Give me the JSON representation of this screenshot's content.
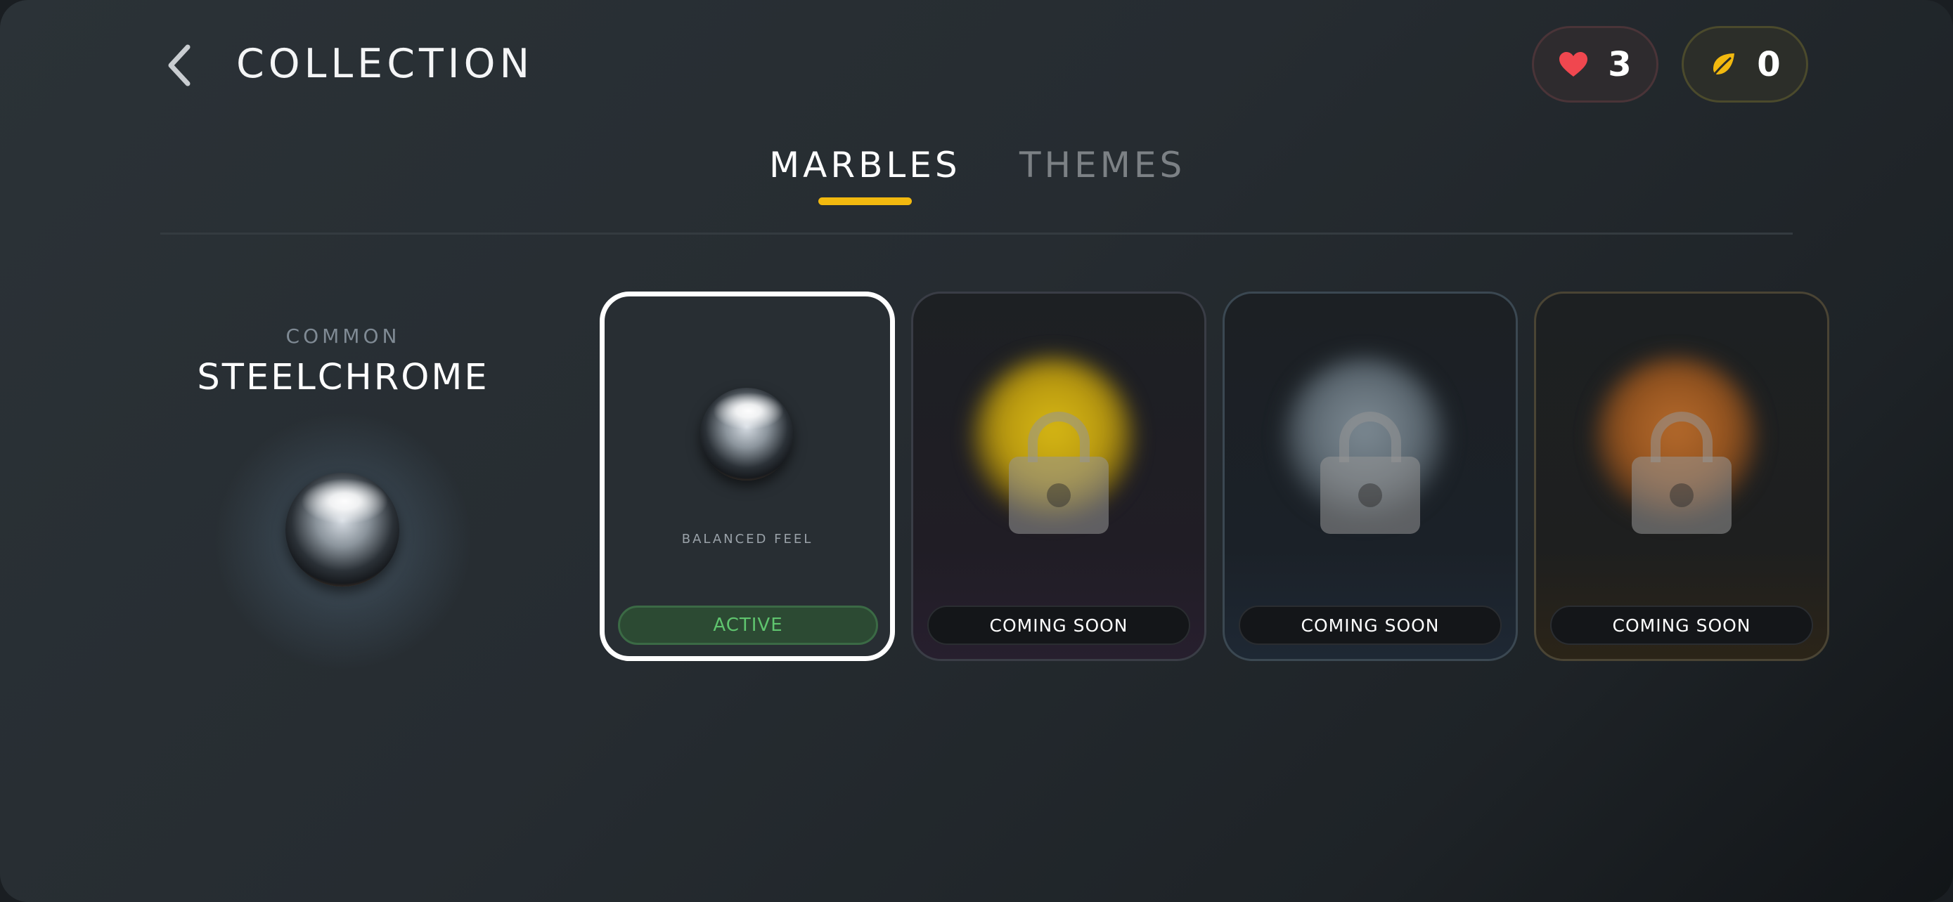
{
  "header": {
    "title": "COLLECTION",
    "lives_count": "3",
    "coins_count": "0"
  },
  "tabs": [
    {
      "label": "MARBLES",
      "selected": true
    },
    {
      "label": "THEMES",
      "selected": false
    }
  ],
  "preview": {
    "rarity": "COMMON",
    "name": "STEELCHROME"
  },
  "cards": [
    {
      "description": "BALANCED FEEL",
      "status": "ACTIVE",
      "locked": false
    },
    {
      "status": "COMING SOON",
      "locked": true,
      "orb_color": "#d7b814"
    },
    {
      "status": "COMING SOON",
      "locked": true,
      "orb_color": "#7d8a93"
    },
    {
      "status": "COMING SOON",
      "locked": true,
      "orb_color": "#b56a2c"
    }
  ],
  "colors": {
    "accent": "#f2b90f",
    "heart": "#f0474f",
    "active_green": "#5fc46e"
  }
}
